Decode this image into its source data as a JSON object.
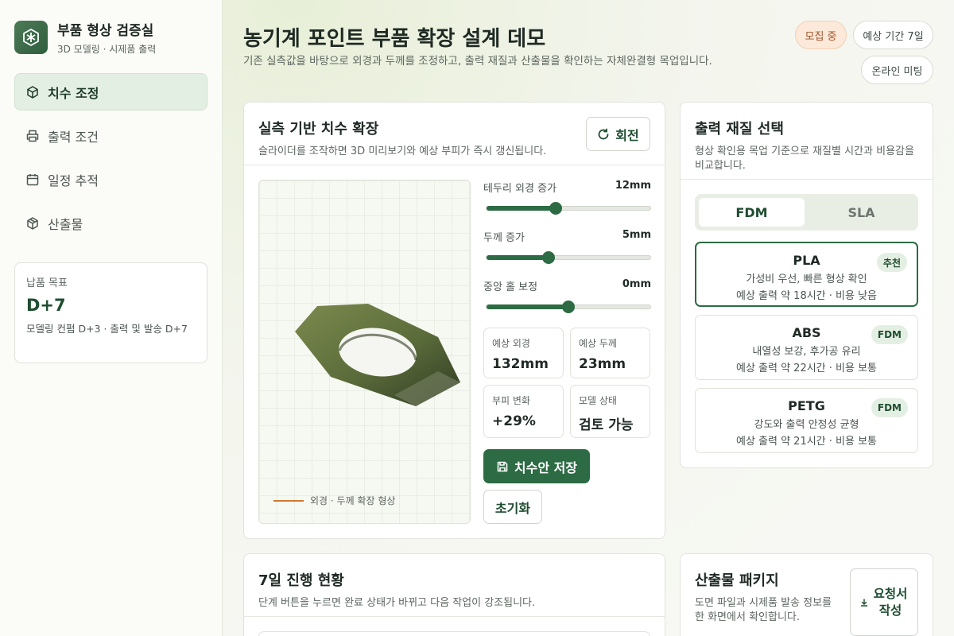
{
  "brand": {
    "title": "부품 형상 검증실",
    "subtitle": "3D 모델링 · 시제품 출력"
  },
  "nav": [
    {
      "label": "치수 조정",
      "icon": "cube-icon",
      "active": true
    },
    {
      "label": "출력 조건",
      "icon": "printer-icon"
    },
    {
      "label": "일정 추적",
      "icon": "calendar-icon"
    },
    {
      "label": "산출물",
      "icon": "package-icon"
    }
  ],
  "goal": {
    "label": "납품 목표",
    "value": "D+7",
    "desc": "모델링 컨펌 D+3 · 출력 및 발송 D+7"
  },
  "header": {
    "title": "농기계 포인트 부품 확장 설계 데모",
    "desc": "기존 실측값을 바탕으로 외경과 두께를 조정하고, 출력 재질과 산출물을 확인하는 자체완결형 목업입니다.",
    "pills": {
      "status": "모집 중",
      "period": "예상 기간 7일",
      "meeting": "온라인 미팅"
    }
  },
  "dimension": {
    "title": "실측 기반 치수 확장",
    "desc": "슬라이더를 조작하면 3D 미리보기와 예상 부피가 즉시 갱신됩니다.",
    "rotate_label": "회전",
    "legend": "외경 · 두께 확장 형상",
    "sliders": [
      {
        "label": "테두리 외경 증가",
        "value": "12mm",
        "fraction": 0.42
      },
      {
        "label": "두께 증가",
        "value": "5mm",
        "fraction": 0.38
      },
      {
        "label": "중앙 홀 보정",
        "value": "0mm",
        "fraction": 0.5
      }
    ],
    "stats": [
      {
        "label": "예상 외경",
        "value": "132mm"
      },
      {
        "label": "예상 두께",
        "value": "23mm"
      },
      {
        "label": "부피 변화",
        "value": "+29%"
      },
      {
        "label": "모델 상태",
        "value": "검토 가능"
      }
    ],
    "save_label": "치수안 저장",
    "reset_label": "초기화"
  },
  "material": {
    "title": "출력 재질 선택",
    "desc": "형상 확인용 목업 기준으로 재질별 시간과 비용감을 비교합니다.",
    "tabs": [
      "FDM",
      "SLA"
    ],
    "items": [
      {
        "name": "PLA",
        "desc": "가성비 우선, 빠른 형상 확인",
        "time": "예상 출력 약 18시간 · 비용 낮음",
        "badge": "추천",
        "selected": true
      },
      {
        "name": "ABS",
        "desc": "내열성 보강, 후가공 유리",
        "time": "예상 출력 약 22시간 · 비용 보통",
        "badge": "FDM"
      },
      {
        "name": "PETG",
        "desc": "강도와 출력 안정성 균형",
        "time": "예상 출력 약 21시간 · 비용 보통",
        "badge": "FDM"
      }
    ]
  },
  "progress": {
    "title": "7일 진행 현황",
    "desc": "단계 버튼을 누르면 완료 상태가 바뀌고 다음 작업이 강조됩니다."
  },
  "package": {
    "title": "산출물 패키지",
    "desc": "도면 파일과 시제품 발송 정보를 한 화면에서 확인합니다.",
    "request_label": "요청서 작성"
  }
}
